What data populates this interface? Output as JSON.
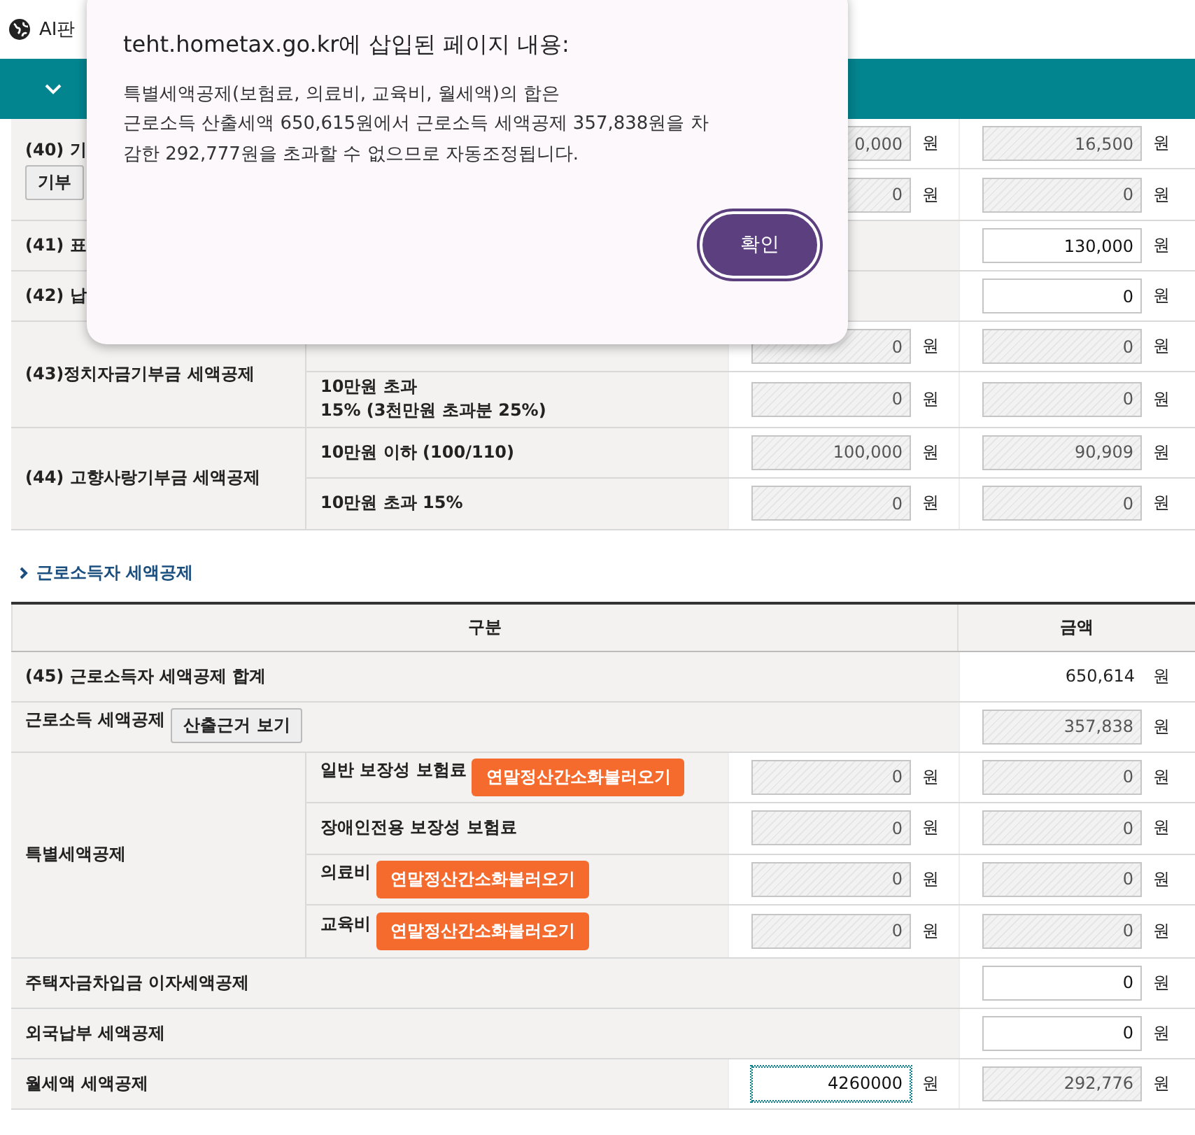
{
  "top_bar": {
    "label": "AI판"
  },
  "table_1": {
    "groups": [
      {
        "kind": "split",
        "label": "(40) 기",
        "button": "기부",
        "subrows": [
          {
            "input_1": {
              "value": "0,000",
              "editable": false,
              "unit": "원"
            },
            "input_2": {
              "value": "16,500",
              "editable": false,
              "unit": "원"
            }
          },
          {
            "input_1": {
              "value": "0",
              "editable": false,
              "unit": "원"
            },
            "input_2": {
              "value": "0",
              "editable": false,
              "unit": "원"
            }
          }
        ]
      },
      {
        "kind": "single",
        "label": "(41) 표",
        "input_2": {
          "value": "130,000",
          "editable": true,
          "unit": "원"
        }
      },
      {
        "kind": "single",
        "label": "(42) 납",
        "input_2": {
          "value": "0",
          "editable": true,
          "unit": "원"
        }
      },
      {
        "kind": "split",
        "label": "(43)정치자금기부금 세액공제",
        "subrows": [
          {
            "input_1": {
              "value": "0",
              "editable": false,
              "unit": "원"
            },
            "input_2": {
              "value": "0",
              "editable": false,
              "unit": "원"
            }
          },
          {
            "label": "10만원 초과\n15% (3천만원 초과분 25%)",
            "input_1": {
              "value": "0",
              "editable": false,
              "unit": "원"
            },
            "input_2": {
              "value": "0",
              "editable": false,
              "unit": "원"
            }
          }
        ]
      },
      {
        "kind": "split",
        "label": "(44) 고향사랑기부금 세액공제",
        "subrows": [
          {
            "label": "10만원 이하 (100/110)",
            "input_1": {
              "value": "100,000",
              "editable": false,
              "unit": "원"
            },
            "input_2": {
              "value": "90,909",
              "editable": false,
              "unit": "원"
            }
          },
          {
            "label": "10만원 초과 15%",
            "input_1": {
              "value": "0",
              "editable": false,
              "unit": "원"
            },
            "input_2": {
              "value": "0",
              "editable": false,
              "unit": "원"
            }
          }
        ]
      }
    ]
  },
  "section_title": "근로소득자 세액공제",
  "table_2": {
    "columns": [
      "구분",
      "금액"
    ],
    "groups": [
      {
        "kind": "single",
        "label": "(45) 근로소득자 세액공제 합계",
        "amount": {
          "value": "650,614",
          "unit": "원"
        }
      },
      {
        "kind": "single",
        "label": "근로소득 세액공제",
        "button": "산출근거 보기",
        "input_2": {
          "value": "357,838",
          "editable": false,
          "unit": "원"
        }
      },
      {
        "kind": "split",
        "label": "특별세액공제",
        "subrows": [
          {
            "label": "일반 보장성 보험료",
            "button": "연말정산간소화불러오기",
            "input_1": {
              "value": "0",
              "editable": false,
              "unit": "원"
            },
            "input_2": {
              "value": "0",
              "editable": false,
              "unit": "원"
            }
          },
          {
            "label": "장애인전용 보장성 보험료",
            "input_1": {
              "value": "0",
              "editable": false,
              "unit": "원"
            },
            "input_2": {
              "value": "0",
              "editable": false,
              "unit": "원"
            }
          },
          {
            "label": "의료비",
            "button": "연말정산간소화불러오기",
            "input_1": {
              "value": "0",
              "editable": false,
              "unit": "원"
            },
            "input_2": {
              "value": "0",
              "editable": false,
              "unit": "원"
            }
          },
          {
            "label": "교육비",
            "button": "연말정산간소화불러오기",
            "input_1": {
              "value": "0",
              "editable": false,
              "unit": "원"
            },
            "input_2": {
              "value": "0",
              "editable": false,
              "unit": "원"
            }
          }
        ]
      },
      {
        "kind": "single",
        "label": "주택자금차입금 이자세액공제",
        "input_2": {
          "value": "0",
          "editable": true,
          "unit": "원"
        }
      },
      {
        "kind": "single",
        "label": "외국납부 세액공제",
        "input_2": {
          "value": "0",
          "editable": true,
          "unit": "원"
        }
      },
      {
        "kind": "single",
        "label": "월세액 세액공제",
        "input_1": {
          "value": "4260000",
          "editable": true,
          "focused": true,
          "unit": "원"
        },
        "input_2": {
          "value": "292,776",
          "editable": false,
          "unit": "원"
        }
      }
    ]
  },
  "dialog": {
    "title": "teht.hometax.go.kr에 삽입된 페이지 내용:",
    "message": [
      "특별세액공제(보험료, 의료비, 교육비, 월세액)의 합은",
      "근로소득 산출세액 650,615원에서 근로소득 세액공제 357,838원을 차",
      "감한 292,777원을 초과할 수 없으므로 자동조정됩니다."
    ],
    "button": "확인"
  }
}
